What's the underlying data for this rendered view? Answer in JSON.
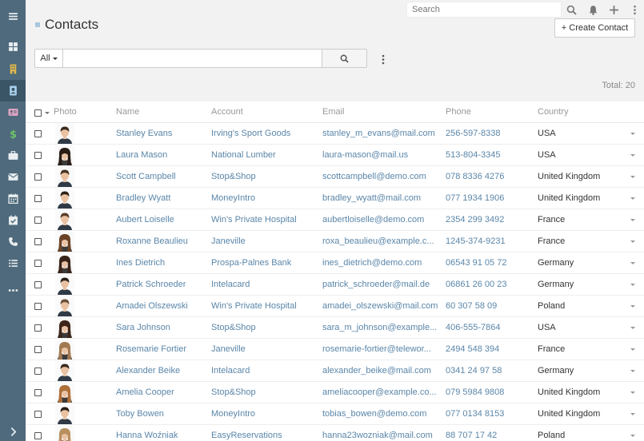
{
  "search": {
    "placeholder": "Search"
  },
  "page": {
    "title": "Contacts",
    "create_label": "+ Create Contact",
    "total": "Total: 20"
  },
  "filter": {
    "scope": "All"
  },
  "table": {
    "headers": {
      "photo": "Photo",
      "name": "Name",
      "account": "Account",
      "email": "Email",
      "phone": "Phone",
      "country": "Country"
    },
    "rows": [
      {
        "name": "Stanley Evans",
        "account": "Irving's Sport Goods",
        "email": "stanley_m_evans@mail.com",
        "phone": "256-597-8338",
        "country": "USA",
        "gender": "m",
        "hair": "#3b2a1e"
      },
      {
        "name": "Laura Mason",
        "account": "National Lumber",
        "email": "laura-mason@mail.us",
        "phone": "513-804-3345",
        "country": "USA",
        "gender": "f",
        "hair": "#2a1d16"
      },
      {
        "name": "Scott Campbell",
        "account": "Stop&Shop",
        "email": "scottcampbell@demo.com",
        "phone": "078 8336 4276",
        "country": "United Kingdom",
        "gender": "m",
        "hair": "#4a3321"
      },
      {
        "name": "Bradley Wyatt",
        "account": "MoneyIntro",
        "email": "bradley_wyatt@mail.com",
        "phone": "077 1934 1906",
        "country": "United Kingdom",
        "gender": "m",
        "hair": "#2d2118"
      },
      {
        "name": "Aubert Loiselle",
        "account": "Win's Private Hospital",
        "email": "aubertloiselle@demo.com",
        "phone": "2354 299 3492",
        "country": "France",
        "gender": "m",
        "hair": "#5a3f2a"
      },
      {
        "name": "Roxanne Beaulieu",
        "account": "Janeville",
        "email": "roxa_beaulieu@example.c...",
        "phone": "1245-374-9231",
        "country": "France",
        "gender": "f",
        "hair": "#6b4428"
      },
      {
        "name": "Ines Dietrich",
        "account": "Prospa-Palnes Bank",
        "email": "ines_dietrich@demo.com",
        "phone": "06543 91 05 72",
        "country": "Germany",
        "gender": "f",
        "hair": "#3a2418"
      },
      {
        "name": "Patrick Schroeder",
        "account": "Intelacard",
        "email": "patrick_schroeder@mail.de",
        "phone": "06861 26 00 23",
        "country": "Germany",
        "gender": "m",
        "hair": "#2b1f17"
      },
      {
        "name": "Amadei Olszewski",
        "account": "Win's Private Hospital",
        "email": "amadei_olszewski@mail.com",
        "phone": "60 307 58 09",
        "country": "Poland",
        "gender": "m",
        "hair": "#6a5038"
      },
      {
        "name": "Sara Johnson",
        "account": "Stop&Shop",
        "email": "sara_m_johnson@example...",
        "phone": "406-555-7864",
        "country": "USA",
        "gender": "f",
        "hair": "#3d2519"
      },
      {
        "name": "Rosemarie Fortier",
        "account": "Janeville",
        "email": "rosemarie-fortier@telewor...",
        "phone": "2494 548 394",
        "country": "France",
        "gender": "f",
        "hair": "#a27a52"
      },
      {
        "name": "Alexander Beike",
        "account": "Intelacard",
        "email": "alexander_beike@mail.com",
        "phone": "0341 24 97 58",
        "country": "Germany",
        "gender": "m",
        "hair": "#3a2a1e"
      },
      {
        "name": "Amelia Cooper",
        "account": "Stop&Shop",
        "email": "ameliacooper@example.co...",
        "phone": "079 5984 9808",
        "country": "United Kingdom",
        "gender": "f",
        "hair": "#b0703a"
      },
      {
        "name": "Toby Bowen",
        "account": "MoneyIntro",
        "email": "tobias_bowen@demo.com",
        "phone": "077 0134 8153",
        "country": "United Kingdom",
        "gender": "m",
        "hair": "#2a1e16"
      },
      {
        "name": "Hanna Woźniak",
        "account": "EasyReservations",
        "email": "hanna23wozniak@mail.com",
        "phone": "88 707 17 42",
        "country": "Poland",
        "gender": "f",
        "hair": "#b89060"
      }
    ]
  },
  "colors": {
    "sidebar": "#4e6a7c",
    "sidebar_active": "#3a5566",
    "link": "#5a86a9",
    "accent": "#a9c7dd"
  },
  "icons": {
    "sidebar": [
      "menu-icon",
      "dashboard-icon",
      "accounts-icon",
      "contacts-icon",
      "leads-icon",
      "opportunities-icon",
      "cases-icon",
      "email-icon",
      "calendar-icon",
      "tasks-icon",
      "calls-icon",
      "list-icon",
      "more-icon",
      "collapse-icon"
    ]
  }
}
